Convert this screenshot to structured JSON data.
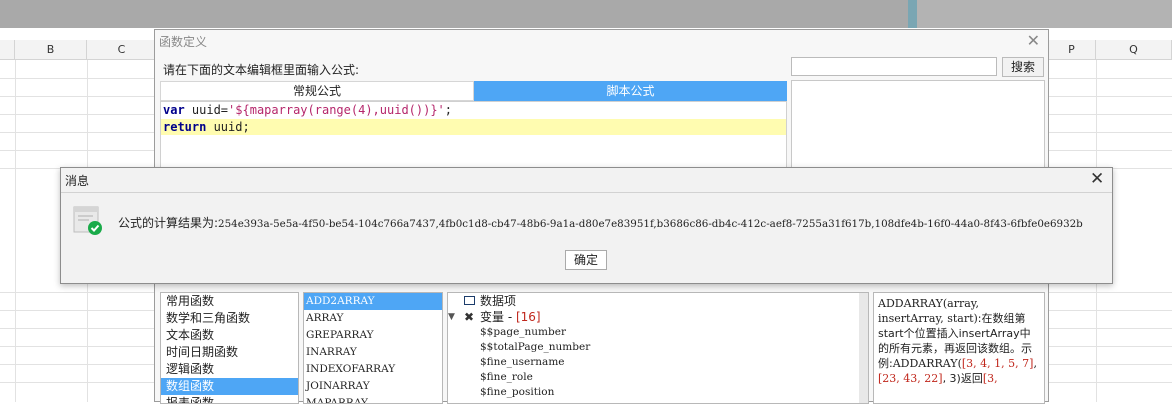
{
  "spreadsheet": {
    "columns_left": [
      "B",
      "C"
    ],
    "columns_right": [
      "P",
      "Q"
    ]
  },
  "function_dialog": {
    "title": "函数定义",
    "prompt": "请在下面的文本编辑框里面输入公式:",
    "search_placeholder": "",
    "search_button": "搜索",
    "tabs": [
      {
        "label": "常规公式",
        "active": false
      },
      {
        "label": "脚本公式",
        "active": true
      }
    ],
    "code": {
      "line1": {
        "kw": "var",
        "mid": " uuid=",
        "str": "'${maparray(range(4),uuid())}'",
        "end": ";"
      },
      "line2": {
        "kw": "return",
        "rest": " uuid;"
      }
    },
    "categories": [
      "常用函数",
      "数学和三角函数",
      "文本函数",
      "时间日期函数",
      "逻辑函数",
      "数组函数",
      "报表函数"
    ],
    "selected_category": "数组函数",
    "functions": [
      "ADD2ARRAY",
      "ARRAY",
      "GREPARRAY",
      "INARRAY",
      "INDEXOFARRAY",
      "JOINARRAY",
      "MAPARRAY"
    ],
    "selected_function": "ADD2ARRAY",
    "tree": {
      "root": "数据项",
      "node_label": "变量 - ",
      "node_count": "[16]",
      "leaves": [
        "$$page_number",
        "$$totalPage_number",
        "$fine_username",
        "$fine_role",
        "$fine_position"
      ]
    },
    "description": {
      "sig": "ADDARRAY(array, insertArray, start)",
      "p1": ":在数组第start个位置插入insertArray中的所有元素，再返回该数组。示例:",
      "example_fn": "ADDARRAY(",
      "arr1": "[3, 4, 1, 5, 7]",
      "sep": ", ",
      "arr2": "[23, 43, 22]",
      "tail": ", 3)返回",
      "result_start": "[3,"
    }
  },
  "message_dialog": {
    "title": "消息",
    "text_label": "公式的计算结果为:",
    "result": "254e393a-5e5a-4f50-be54-104c766a7437,4fb0c1d8-cb47-48b6-9a1a-d80e7e83951f,b3686c86-db4c-412c-aef8-7255a31f617b,108dfe4b-16f0-44a0-8f43-6fbfe0e6932b",
    "ok_button": "确定"
  },
  "colors": {
    "accent": "#4ea6f5",
    "highlight_line": "#fffcb0",
    "success": "#1aab4a"
  }
}
